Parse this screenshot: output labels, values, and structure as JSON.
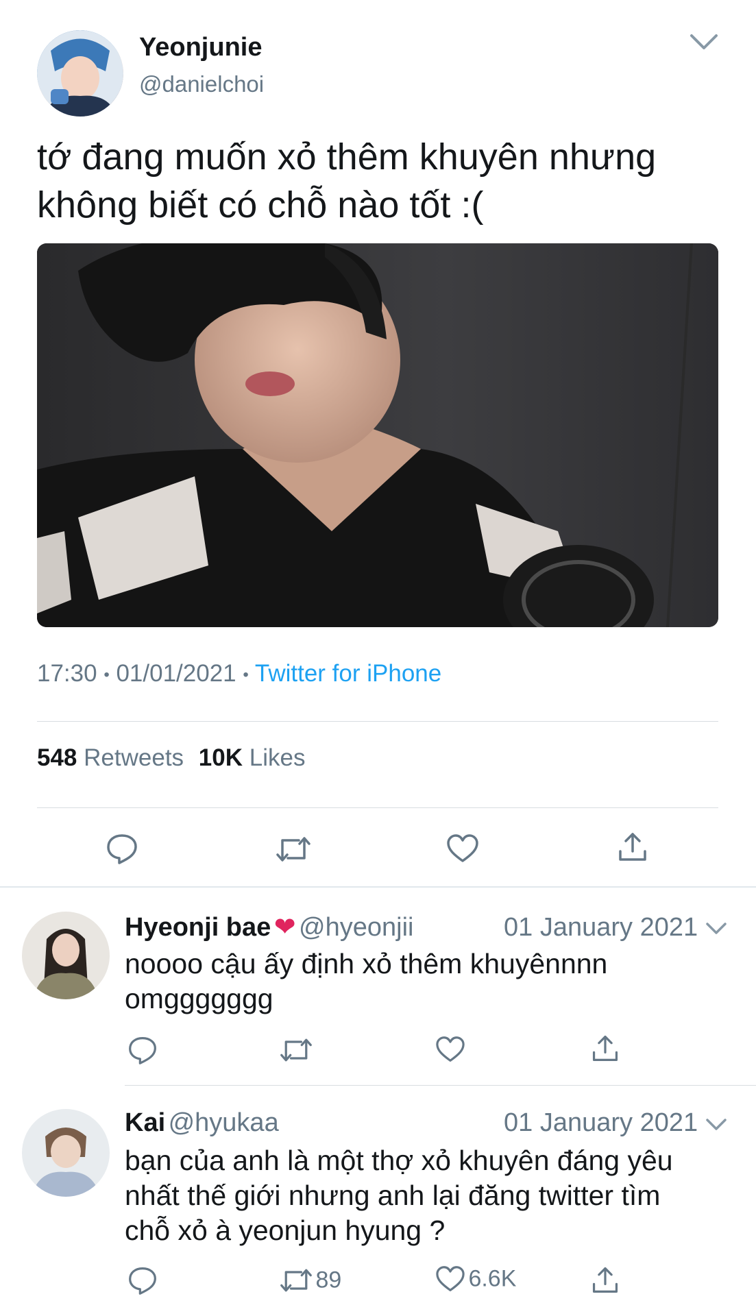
{
  "tweet": {
    "author_name": "Yeonjunie",
    "author_handle": "@danielchoi",
    "text_line1": "tớ đang muốn xỏ thêm khuyên nhưng",
    "text_line2": "không biết có chỗ nào tốt :(",
    "time": "17:30",
    "date": "01/01/2021",
    "separator": "•",
    "source": "Twitter for iPhone",
    "retweets_count": "548",
    "retweets_label": "Retweets",
    "likes_count": "10K",
    "likes_label": "Likes"
  },
  "replies": [
    {
      "name": "Hyeonji bae",
      "heart": "❤",
      "handle": "@hyeonjii",
      "date": "01 January 2021",
      "lines": [
        "noooo cậu ấy định xỏ thêm khuyênnnn",
        "omggggggg"
      ]
    },
    {
      "name": "Kai",
      "handle": "@hyukaa",
      "date": "01 January 2021",
      "lines": [
        "bạn của anh là một thợ xỏ khuyên đáng yêu",
        "nhất thế giới nhưng anh lại đăng twitter tìm",
        "chỗ xỏ à yeonjun hyung ?"
      ],
      "retweet_count": "89",
      "like_count": "6.6K"
    }
  ],
  "icons": {
    "reply": "reply-icon",
    "retweet": "retweet-icon",
    "like": "heart-icon",
    "share": "share-icon",
    "chevron": "chevron-down-icon"
  },
  "colors": {
    "accent": "#1da1f2",
    "muted": "#657786",
    "text": "#14171a",
    "heart_red": "#e0245e"
  }
}
